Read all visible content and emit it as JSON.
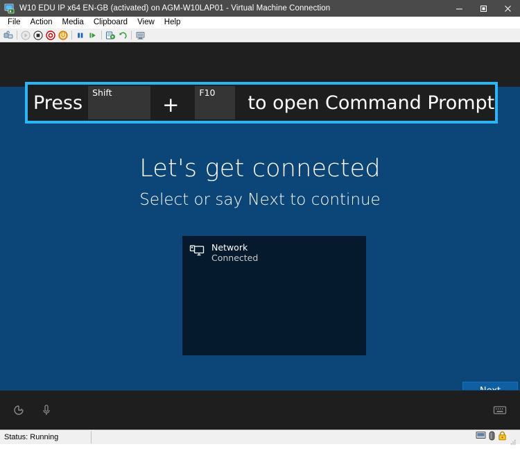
{
  "window": {
    "title": "W10 EDU IP x64 EN-GB (activated) on AGM-W10LAP01 - Virtual Machine Connection",
    "icon": "virtual-machine-icon",
    "controls": {
      "minimize": "minimize-icon",
      "restore": "restore-icon",
      "close": "close-icon"
    }
  },
  "menubar": {
    "items": [
      {
        "label": "File"
      },
      {
        "label": "Action"
      },
      {
        "label": "Media"
      },
      {
        "label": "Clipboard"
      },
      {
        "label": "View"
      },
      {
        "label": "Help"
      }
    ]
  },
  "toolbar": {
    "buttons": [
      {
        "name": "ctrl-alt-delete-icon",
        "tooltip": "Ctrl+Alt+Delete"
      },
      {
        "name": "start-icon",
        "tooltip": "Start"
      },
      {
        "name": "turn-off-icon",
        "tooltip": "Turn Off"
      },
      {
        "name": "shut-down-icon",
        "tooltip": "Shut Down"
      },
      {
        "name": "save-state-icon",
        "tooltip": "Save"
      },
      {
        "name": "pause-icon",
        "tooltip": "Pause"
      },
      {
        "name": "reset-icon",
        "tooltip": "Reset"
      },
      {
        "name": "checkpoint-icon",
        "tooltip": "Checkpoint"
      },
      {
        "name": "revert-icon",
        "tooltip": "Revert"
      },
      {
        "name": "enhanced-session-icon",
        "tooltip": "Enhanced Session"
      }
    ]
  },
  "banner": {
    "prefix": "Press",
    "key1": "Shift",
    "separator": "+",
    "key2": "F10",
    "suffix": "to open Command Prompt",
    "border_color": "#29b6f6",
    "background_color": "#1e1e1e"
  },
  "oobe": {
    "title": "Let's get connected",
    "subtitle": "Select or say Next to continue",
    "background_color": "#0c4678",
    "networks": [
      {
        "icon": "network-computer-icon",
        "name": "Network",
        "status": "Connected"
      }
    ],
    "next_button": {
      "label": "Next",
      "color": "#0f5fa3"
    },
    "bottom_bar": {
      "ease_of_access_icon": "ease-of-access-icon",
      "microphone_icon": "microphone-icon",
      "keyboard_icon": "on-screen-keyboard-icon"
    }
  },
  "statusbar": {
    "status": "Status: Running",
    "icons": [
      {
        "name": "display-status-icon"
      },
      {
        "name": "usb-device-icon"
      },
      {
        "name": "lock-icon",
        "color": "#ffc40d"
      }
    ]
  }
}
